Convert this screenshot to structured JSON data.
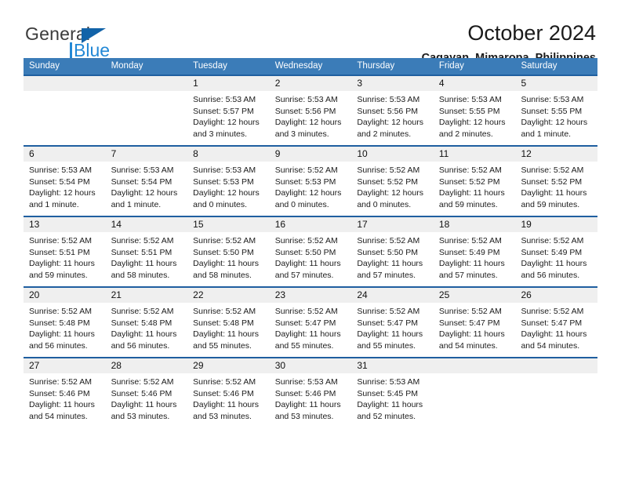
{
  "brand": {
    "name_part1": "General",
    "name_part2": "Blue",
    "triangle_icon": "triangle-icon",
    "accent_dark": "#1263a8",
    "accent_light": "#2288d6"
  },
  "header": {
    "title": "October 2024",
    "subtitle": "Cagayan, Mimaropa, Philippines"
  },
  "theme": {
    "header_blue": "#3b7cb8",
    "separator_blue": "#1f5fa0",
    "daynum_band": "#efefef"
  },
  "weekdays": [
    "Sunday",
    "Monday",
    "Tuesday",
    "Wednesday",
    "Thursday",
    "Friday",
    "Saturday"
  ],
  "weeks": [
    [
      {
        "day": "",
        "lines": []
      },
      {
        "day": "",
        "lines": []
      },
      {
        "day": "1",
        "lines": [
          "Sunrise: 5:53 AM",
          "Sunset: 5:57 PM",
          "Daylight: 12 hours",
          "and 3 minutes."
        ]
      },
      {
        "day": "2",
        "lines": [
          "Sunrise: 5:53 AM",
          "Sunset: 5:56 PM",
          "Daylight: 12 hours",
          "and 3 minutes."
        ]
      },
      {
        "day": "3",
        "lines": [
          "Sunrise: 5:53 AM",
          "Sunset: 5:56 PM",
          "Daylight: 12 hours",
          "and 2 minutes."
        ]
      },
      {
        "day": "4",
        "lines": [
          "Sunrise: 5:53 AM",
          "Sunset: 5:55 PM",
          "Daylight: 12 hours",
          "and 2 minutes."
        ]
      },
      {
        "day": "5",
        "lines": [
          "Sunrise: 5:53 AM",
          "Sunset: 5:55 PM",
          "Daylight: 12 hours",
          "and 1 minute."
        ]
      }
    ],
    [
      {
        "day": "6",
        "lines": [
          "Sunrise: 5:53 AM",
          "Sunset: 5:54 PM",
          "Daylight: 12 hours",
          "and 1 minute."
        ]
      },
      {
        "day": "7",
        "lines": [
          "Sunrise: 5:53 AM",
          "Sunset: 5:54 PM",
          "Daylight: 12 hours",
          "and 1 minute."
        ]
      },
      {
        "day": "8",
        "lines": [
          "Sunrise: 5:53 AM",
          "Sunset: 5:53 PM",
          "Daylight: 12 hours",
          "and 0 minutes."
        ]
      },
      {
        "day": "9",
        "lines": [
          "Sunrise: 5:52 AM",
          "Sunset: 5:53 PM",
          "Daylight: 12 hours",
          "and 0 minutes."
        ]
      },
      {
        "day": "10",
        "lines": [
          "Sunrise: 5:52 AM",
          "Sunset: 5:52 PM",
          "Daylight: 12 hours",
          "and 0 minutes."
        ]
      },
      {
        "day": "11",
        "lines": [
          "Sunrise: 5:52 AM",
          "Sunset: 5:52 PM",
          "Daylight: 11 hours",
          "and 59 minutes."
        ]
      },
      {
        "day": "12",
        "lines": [
          "Sunrise: 5:52 AM",
          "Sunset: 5:52 PM",
          "Daylight: 11 hours",
          "and 59 minutes."
        ]
      }
    ],
    [
      {
        "day": "13",
        "lines": [
          "Sunrise: 5:52 AM",
          "Sunset: 5:51 PM",
          "Daylight: 11 hours",
          "and 59 minutes."
        ]
      },
      {
        "day": "14",
        "lines": [
          "Sunrise: 5:52 AM",
          "Sunset: 5:51 PM",
          "Daylight: 11 hours",
          "and 58 minutes."
        ]
      },
      {
        "day": "15",
        "lines": [
          "Sunrise: 5:52 AM",
          "Sunset: 5:50 PM",
          "Daylight: 11 hours",
          "and 58 minutes."
        ]
      },
      {
        "day": "16",
        "lines": [
          "Sunrise: 5:52 AM",
          "Sunset: 5:50 PM",
          "Daylight: 11 hours",
          "and 57 minutes."
        ]
      },
      {
        "day": "17",
        "lines": [
          "Sunrise: 5:52 AM",
          "Sunset: 5:50 PM",
          "Daylight: 11 hours",
          "and 57 minutes."
        ]
      },
      {
        "day": "18",
        "lines": [
          "Sunrise: 5:52 AM",
          "Sunset: 5:49 PM",
          "Daylight: 11 hours",
          "and 57 minutes."
        ]
      },
      {
        "day": "19",
        "lines": [
          "Sunrise: 5:52 AM",
          "Sunset: 5:49 PM",
          "Daylight: 11 hours",
          "and 56 minutes."
        ]
      }
    ],
    [
      {
        "day": "20",
        "lines": [
          "Sunrise: 5:52 AM",
          "Sunset: 5:48 PM",
          "Daylight: 11 hours",
          "and 56 minutes."
        ]
      },
      {
        "day": "21",
        "lines": [
          "Sunrise: 5:52 AM",
          "Sunset: 5:48 PM",
          "Daylight: 11 hours",
          "and 56 minutes."
        ]
      },
      {
        "day": "22",
        "lines": [
          "Sunrise: 5:52 AM",
          "Sunset: 5:48 PM",
          "Daylight: 11 hours",
          "and 55 minutes."
        ]
      },
      {
        "day": "23",
        "lines": [
          "Sunrise: 5:52 AM",
          "Sunset: 5:47 PM",
          "Daylight: 11 hours",
          "and 55 minutes."
        ]
      },
      {
        "day": "24",
        "lines": [
          "Sunrise: 5:52 AM",
          "Sunset: 5:47 PM",
          "Daylight: 11 hours",
          "and 55 minutes."
        ]
      },
      {
        "day": "25",
        "lines": [
          "Sunrise: 5:52 AM",
          "Sunset: 5:47 PM",
          "Daylight: 11 hours",
          "and 54 minutes."
        ]
      },
      {
        "day": "26",
        "lines": [
          "Sunrise: 5:52 AM",
          "Sunset: 5:47 PM",
          "Daylight: 11 hours",
          "and 54 minutes."
        ]
      }
    ],
    [
      {
        "day": "27",
        "lines": [
          "Sunrise: 5:52 AM",
          "Sunset: 5:46 PM",
          "Daylight: 11 hours",
          "and 54 minutes."
        ]
      },
      {
        "day": "28",
        "lines": [
          "Sunrise: 5:52 AM",
          "Sunset: 5:46 PM",
          "Daylight: 11 hours",
          "and 53 minutes."
        ]
      },
      {
        "day": "29",
        "lines": [
          "Sunrise: 5:52 AM",
          "Sunset: 5:46 PM",
          "Daylight: 11 hours",
          "and 53 minutes."
        ]
      },
      {
        "day": "30",
        "lines": [
          "Sunrise: 5:53 AM",
          "Sunset: 5:46 PM",
          "Daylight: 11 hours",
          "and 53 minutes."
        ]
      },
      {
        "day": "31",
        "lines": [
          "Sunrise: 5:53 AM",
          "Sunset: 5:45 PM",
          "Daylight: 11 hours",
          "and 52 minutes."
        ]
      },
      {
        "day": "",
        "lines": []
      },
      {
        "day": "",
        "lines": []
      }
    ]
  ]
}
